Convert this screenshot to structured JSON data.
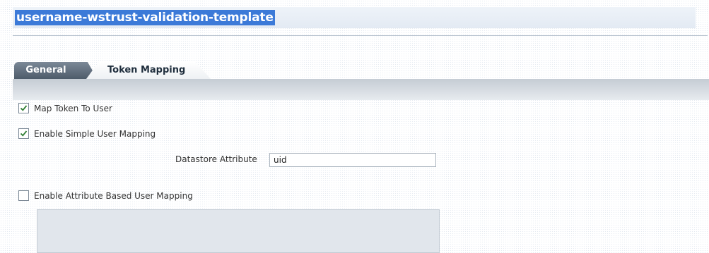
{
  "title": "username-wstrust-validation-template",
  "tabs": [
    {
      "label": "General",
      "selected": false
    },
    {
      "label": "Token Mapping",
      "selected": true
    }
  ],
  "form": {
    "map_token_to_user": {
      "label": "Map Token To User",
      "checked": true
    },
    "enable_simple_user_mapping": {
      "label": "Enable Simple User Mapping",
      "checked": true
    },
    "datastore_attribute": {
      "label": "Datastore Attribute",
      "value": "uid"
    },
    "enable_attribute_based_user_mapping": {
      "label": "Enable Attribute Based User Mapping",
      "checked": false
    }
  },
  "icons": {
    "checkmark": "checkmark-icon"
  },
  "colors": {
    "title_highlight": "#3c7ad8",
    "tab_active_bg": "#ffffff",
    "tab_inactive_bg": "#4d5b6a",
    "checkmark": "#2e7d32"
  }
}
